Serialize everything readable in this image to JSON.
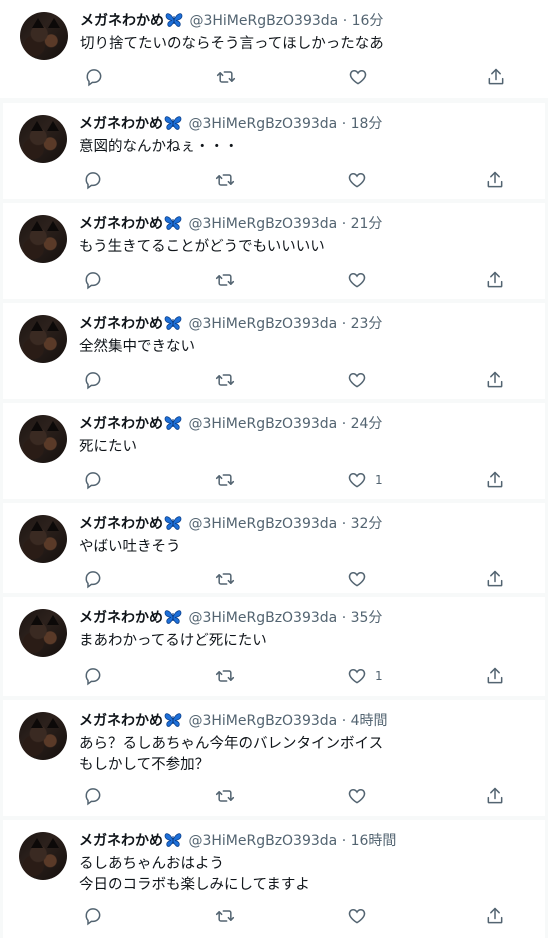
{
  "user": {
    "name": "メガネわかめ",
    "handle": "@3HiMeRgBzO393da",
    "separator": "·"
  },
  "colors": {
    "background": "#f7f9f9",
    "card": "#ffffff",
    "text": "#0f1419",
    "secondary": "#536471",
    "butterfly": "#1d6fd8"
  },
  "icons": {
    "reply": "reply-icon",
    "retweet": "retweet-icon",
    "like": "heart-icon",
    "share": "share-icon",
    "name_badge": "butterfly-icon"
  },
  "tweets": [
    {
      "time": "16分",
      "text": "切り捨てたいのならそう言ってほしかったなあ",
      "like_count": ""
    },
    {
      "time": "18分",
      "text": "意図的なんかねぇ・・・",
      "like_count": ""
    },
    {
      "time": "21分",
      "text": "もう生きてることがどうでもいいいい",
      "like_count": ""
    },
    {
      "time": "23分",
      "text": "全然集中できない",
      "like_count": ""
    },
    {
      "time": "24分",
      "text": "死にたい",
      "like_count": "1"
    },
    {
      "time": "32分",
      "text": "やばい吐きそう",
      "like_count": ""
    },
    {
      "time": "35分",
      "text": "まあわかってるけど死にたい",
      "like_count": "1"
    },
    {
      "time": "4時間",
      "text": "あら？るしあちゃん今年のバレンタインボイス\nもしかして不参加？",
      "like_count": ""
    },
    {
      "time": "16時間",
      "text": "るしあちゃんおはよう\n今日のコラボも楽しみにしてますよ",
      "like_count": ""
    }
  ]
}
